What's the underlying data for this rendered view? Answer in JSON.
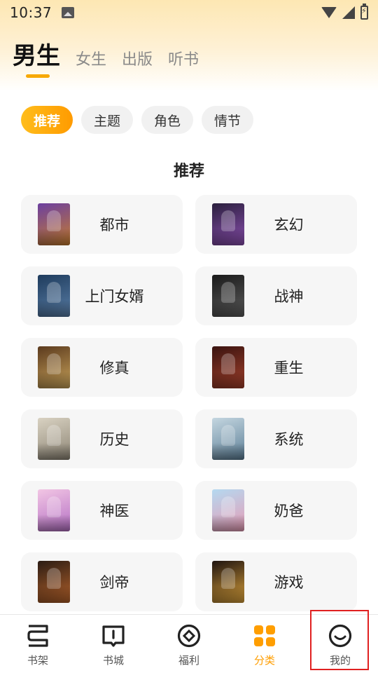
{
  "status_bar": {
    "time": "10:37"
  },
  "top_tabs": [
    {
      "label": "男生",
      "active": true
    },
    {
      "label": "女生",
      "active": false
    },
    {
      "label": "出版",
      "active": false
    },
    {
      "label": "听书",
      "active": false
    }
  ],
  "chips": [
    {
      "label": "推荐",
      "active": true
    },
    {
      "label": "主题",
      "active": false
    },
    {
      "label": "角色",
      "active": false
    },
    {
      "label": "情节",
      "active": false
    }
  ],
  "section_title": "推荐",
  "categories": [
    {
      "label": "都市",
      "cover_color": "#6b3fa0",
      "cover_color2": "#c77d2e"
    },
    {
      "label": "玄幻",
      "cover_color": "#2a1f3d",
      "cover_color2": "#8b4fb0"
    },
    {
      "label": "上门女婿",
      "cover_color": "#1e3b5c",
      "cover_color2": "#5a7fa8"
    },
    {
      "label": "战神",
      "cover_color": "#1a1a1a",
      "cover_color2": "#5c5c5c"
    },
    {
      "label": "修真",
      "cover_color": "#5b3a1e",
      "cover_color2": "#c9a35a"
    },
    {
      "label": "重生",
      "cover_color": "#3a1410",
      "cover_color2": "#a3402b"
    },
    {
      "label": "历史",
      "cover_color": "#d9d2c2",
      "cover_color2": "#8c8474"
    },
    {
      "label": "系统",
      "cover_color": "#c4d6e0",
      "cover_color2": "#5b7e96"
    },
    {
      "label": "神医",
      "cover_color": "#f2c6e4",
      "cover_color2": "#b46fc4"
    },
    {
      "label": "奶爸",
      "cover_color": "#b4d9f0",
      "cover_color2": "#e79bb5"
    },
    {
      "label": "剑帝",
      "cover_color": "#2b1c14",
      "cover_color2": "#b5622a"
    },
    {
      "label": "游戏",
      "cover_color": "#1f1410",
      "cover_color2": "#d9a03a"
    }
  ],
  "bottom_nav": [
    {
      "label": "书架",
      "icon": "bookshelf-icon",
      "active": false
    },
    {
      "label": "书城",
      "icon": "book-store-icon",
      "active": false
    },
    {
      "label": "福利",
      "icon": "welfare-icon",
      "active": false
    },
    {
      "label": "分类",
      "icon": "category-icon",
      "active": true
    },
    {
      "label": "我的",
      "icon": "profile-icon",
      "active": false
    }
  ],
  "colors": {
    "accent": "#ff9e00",
    "highlight_box": "#e02020"
  }
}
